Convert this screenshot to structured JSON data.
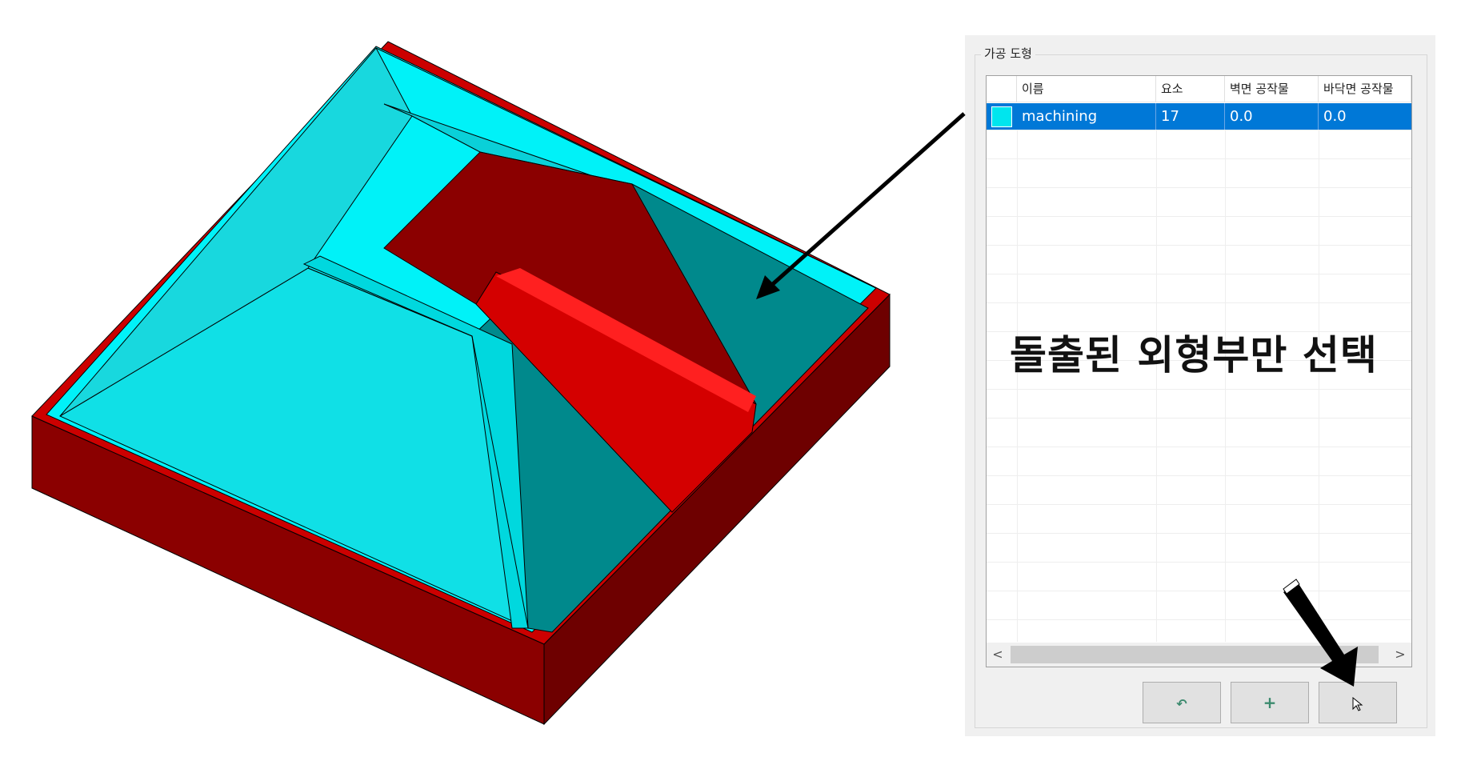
{
  "panel": {
    "group_title": "가공 도형",
    "columns": [
      "",
      "이름",
      "요소",
      "벽면 공작물",
      "바닥면 공작물"
    ],
    "rows": [
      {
        "color": "#00e5ee",
        "name": "machining",
        "elements": "17",
        "wall_stock": "0.0",
        "floor_stock": "0.0"
      }
    ],
    "scroll_left": "<",
    "scroll_right": ">",
    "buttons": {
      "undo_icon": "↶",
      "add_icon": "+",
      "pick_icon": "cursor-icon"
    }
  },
  "annotation": {
    "caption": "돌출된 외형부만 선택"
  },
  "colors": {
    "cyan": "#00e5ee",
    "red": "#cc0000",
    "dark_red": "#8b0000",
    "selection": "#0078d7"
  }
}
